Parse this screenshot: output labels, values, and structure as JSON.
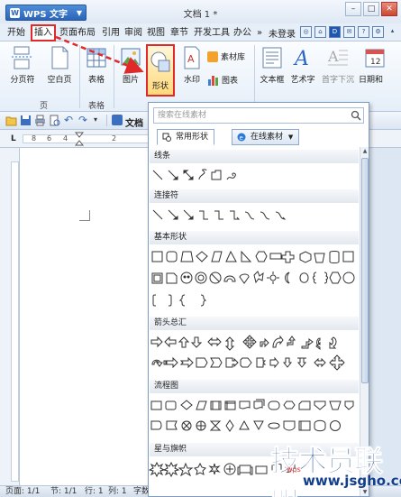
{
  "titlebar": {
    "app_name": "WPS 文字",
    "doc_title": "文档 1 *",
    "controls": [
      "–",
      "□",
      "✕"
    ]
  },
  "menubar": {
    "tabs": [
      "开始",
      "插入",
      "页面布局",
      "引用",
      "审阅",
      "视图",
      "章节",
      "开发工具",
      "办公"
    ],
    "more": "»",
    "login_status": "未登录"
  },
  "ribbon": {
    "buttons": {
      "page_break": "分页符",
      "blank_page": "空白页",
      "table": "表格",
      "picture": "图片",
      "shape": "形状",
      "watermark": "水印",
      "material_library": "素材库",
      "chart": "图表",
      "text_box": "文本框",
      "art_text": "艺术字",
      "drop_cap": "首字下沉",
      "date": "日期和"
    },
    "groups": {
      "page": "页",
      "table": "表格"
    }
  },
  "qat": {
    "doc_tab": "文档"
  },
  "ruler": {
    "marks": [
      "8",
      "6",
      "4",
      "2",
      "2"
    ],
    "tab_stop": "L"
  },
  "statusbar": {
    "page": "页面: 1/1",
    "section": "节: 1/1",
    "row": "行: 1",
    "col": "列: 1",
    "chars": "字数"
  },
  "shapes_panel": {
    "search_placeholder": "搜索在线素材",
    "tab_common": "常用形状",
    "tab_online": "在线素材",
    "categories": {
      "lines": "线条",
      "connectors": "连接符",
      "basic": "基本形状",
      "arrows": "箭头总汇",
      "flowchart": "流程图",
      "stars": "星与旗帜"
    }
  },
  "watermark": {
    "site_name": "技术员联盟",
    "url": "www.jsgho.com",
    "small": "wps"
  }
}
